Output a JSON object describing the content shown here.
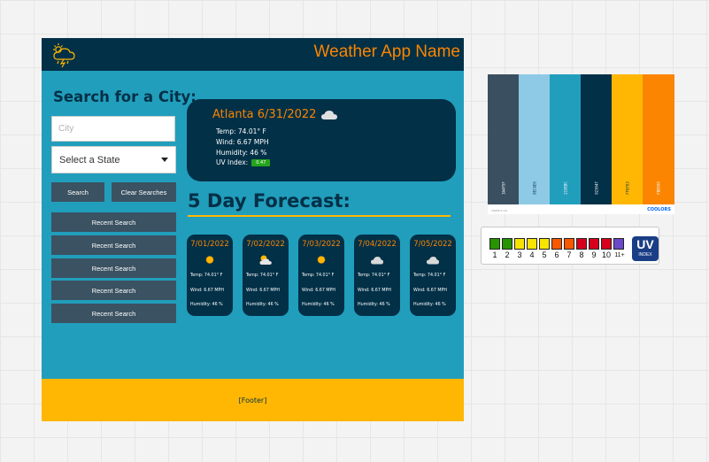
{
  "header": {
    "title": "Weather App Name",
    "logo_icon": "storm-cloud-icon"
  },
  "search": {
    "heading": "Search for a City:",
    "city_placeholder": "City",
    "state_value": "Select a State",
    "search_button": "Search",
    "clear_button": "Clear Searches",
    "recent": [
      "Recent Search",
      "Recent Search",
      "Recent Search",
      "Recent Search",
      "Recent Search"
    ]
  },
  "current": {
    "title": "Atlanta 6/31/2022",
    "icon": "cloud-icon",
    "temp": "Temp: 74.01° F",
    "wind": "Wind: 6.67 MPH",
    "humidity": "Humidity: 46 %",
    "uv_label": "UV Index:",
    "uv_value": "0.47",
    "uv_color": "#23a41a"
  },
  "forecast": {
    "heading": "5 Day Forecast:",
    "days": [
      {
        "date": "7/01/2022",
        "icon": "sun-icon",
        "temp": "Temp: 74.01° F",
        "wind": "Wind: 6.67 MPH",
        "humidity": "Humidity: 46 %"
      },
      {
        "date": "7/02/2022",
        "icon": "partly-cloudy-icon",
        "temp": "Temp: 74.01° F",
        "wind": "Wind: 6.67 MPH",
        "humidity": "Humidity: 46 %"
      },
      {
        "date": "7/03/2022",
        "icon": "sun-icon",
        "temp": "Temp: 74.01° F",
        "wind": "Wind: 6.67 MPH",
        "humidity": "Humidity: 46 %"
      },
      {
        "date": "7/04/2022",
        "icon": "cloud-icon",
        "temp": "Temp: 74.01° F",
        "wind": "Wind: 6.67 MPH",
        "humidity": "Humidity: 46 %"
      },
      {
        "date": "7/05/2022",
        "icon": "cloud-icon",
        "temp": "Temp: 74.01° F",
        "wind": "Wind: 6.67 MPH",
        "humidity": "Humidity: 46 %"
      }
    ]
  },
  "footer": {
    "text": "[Footer]"
  },
  "palette": {
    "colors": [
      "#3A4F5F",
      "#8ECAE6",
      "#219EBC",
      "#023047",
      "#FFB703",
      "#FB8500"
    ],
    "labels": [
      "3A4F5F",
      "8ECAE6",
      "219EBC",
      "023047",
      "FFB703",
      "FB8500"
    ],
    "source": "coolors.co",
    "brand": "COOLORS"
  },
  "uv_scale": {
    "numbers": [
      "1",
      "2",
      "3",
      "4",
      "5",
      "6",
      "7",
      "8",
      "9",
      "10",
      "11+"
    ],
    "colors": [
      "#289500",
      "#289500",
      "#f7e400",
      "#f7e400",
      "#f7e400",
      "#f85900",
      "#f85900",
      "#d8001d",
      "#d8001d",
      "#d8001d",
      "#6b49c8"
    ],
    "logo_big": "UV",
    "logo_small": "INDEX"
  }
}
